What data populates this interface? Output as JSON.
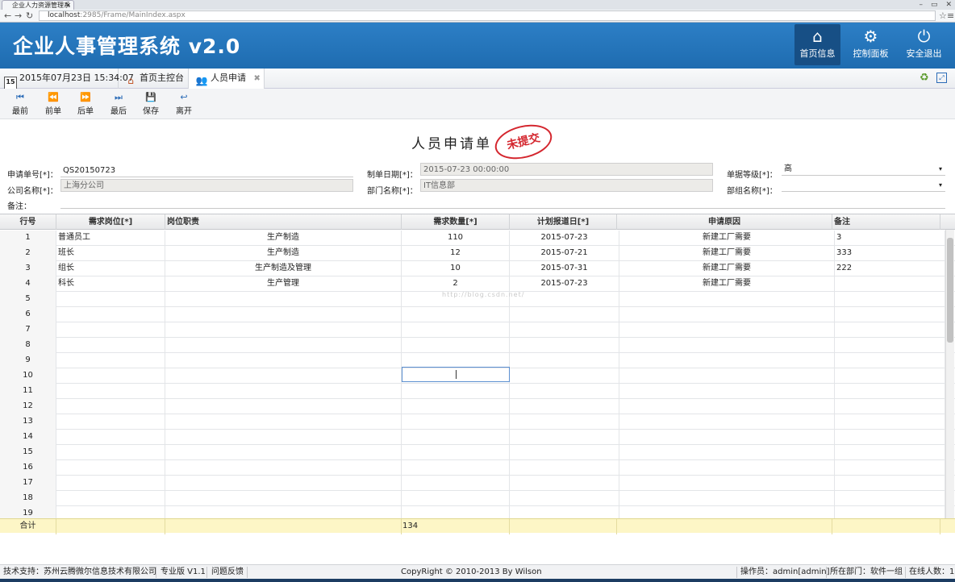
{
  "browser": {
    "tab_title": "企业人力资源管理系",
    "url_host": "localhost",
    "url_rest": ":2985/Frame/MainIndex.aspx"
  },
  "header": {
    "title": "企业人事管理系统 v2.0",
    "buttons": [
      {
        "label": "首页信息",
        "icon": "home-icon"
      },
      {
        "label": "控制面板",
        "icon": "gears-icon"
      },
      {
        "label": "安全退出",
        "icon": "power-icon"
      }
    ],
    "color": "#1e6cb0"
  },
  "tabs": {
    "datetime": "2015年07月23日 15:34:07",
    "calendar_day": "15",
    "items": [
      {
        "label": "首页主控台"
      },
      {
        "label": "人员申请"
      }
    ]
  },
  "toolbar": {
    "buttons": [
      {
        "label": "最前",
        "icon": "first-icon"
      },
      {
        "label": "前单",
        "icon": "prev-icon"
      },
      {
        "label": "后单",
        "icon": "next-icon"
      },
      {
        "label": "最后",
        "icon": "last-icon"
      },
      {
        "label": "保存",
        "icon": "save-icon"
      },
      {
        "label": "离开",
        "icon": "exit-icon"
      }
    ]
  },
  "form": {
    "title": "人员申请单",
    "stamp": "未提交",
    "fields": {
      "order_no": {
        "label": "申请单号[*]：",
        "value": "QS20150723"
      },
      "company": {
        "label": "公司名称[*]：",
        "value": "上海分公司"
      },
      "remark": {
        "label": "备注：",
        "value": ""
      },
      "make_date": {
        "label": "制单日期[*]：",
        "value": "2015-07-23 00:00:00"
      },
      "dept": {
        "label": "部门名称[*]：",
        "value": "IT信息部"
      },
      "level": {
        "label": "单据等级[*]：",
        "value": "高"
      },
      "group": {
        "label": "部组名称[*]：",
        "value": ""
      }
    }
  },
  "grid": {
    "headers": [
      "行号",
      "需求岗位[*]",
      "岗位职责",
      "需求数量[*]",
      "计划报道日[*]",
      "申请原因",
      "备注"
    ],
    "rows": [
      [
        "1",
        "普通员工",
        "生产制造",
        "110",
        "2015-07-23",
        "新建工厂需要",
        "3"
      ],
      [
        "2",
        "班长",
        "生产制造",
        "12",
        "2015-07-21",
        "新建工厂需要",
        "333"
      ],
      [
        "3",
        "组长",
        "生产制造及管理",
        "10",
        "2015-07-31",
        "新建工厂需要",
        "222"
      ],
      [
        "4",
        "科长",
        "生产管理",
        "2",
        "2015-07-23",
        "新建工厂需要",
        ""
      ],
      [
        "5",
        "",
        "",
        "",
        "",
        "",
        ""
      ],
      [
        "6",
        "",
        "",
        "",
        "",
        "",
        ""
      ],
      [
        "7",
        "",
        "",
        "",
        "",
        "",
        ""
      ],
      [
        "8",
        "",
        "",
        "",
        "",
        "",
        ""
      ],
      [
        "9",
        "",
        "",
        "",
        "",
        "",
        ""
      ],
      [
        "10",
        "",
        "",
        "",
        "",
        "",
        ""
      ],
      [
        "11",
        "",
        "",
        "",
        "",
        "",
        ""
      ],
      [
        "12",
        "",
        "",
        "",
        "",
        "",
        ""
      ],
      [
        "13",
        "",
        "",
        "",
        "",
        "",
        ""
      ],
      [
        "14",
        "",
        "",
        "",
        "",
        "",
        ""
      ],
      [
        "15",
        "",
        "",
        "",
        "",
        "",
        ""
      ],
      [
        "16",
        "",
        "",
        "",
        "",
        "",
        ""
      ],
      [
        "17",
        "",
        "",
        "",
        "",
        "",
        ""
      ],
      [
        "18",
        "",
        "",
        "",
        "",
        "",
        ""
      ],
      [
        "19",
        "",
        "",
        "",
        "",
        "",
        ""
      ]
    ],
    "total_label": "合计",
    "total_qty": "134",
    "watermark": "http://blog.csdn.net/"
  },
  "status": {
    "support": "技术支持：苏州云腾微尔信息技术有限公司",
    "edition": "专业版 V1.1",
    "feedback": "问题反馈",
    "copyright": "CopyRight © 2010-2013 By Wilson",
    "operator": "操作员：admin[admin]",
    "dept": "所在部门：软件一组",
    "online": "在线人数：1"
  }
}
